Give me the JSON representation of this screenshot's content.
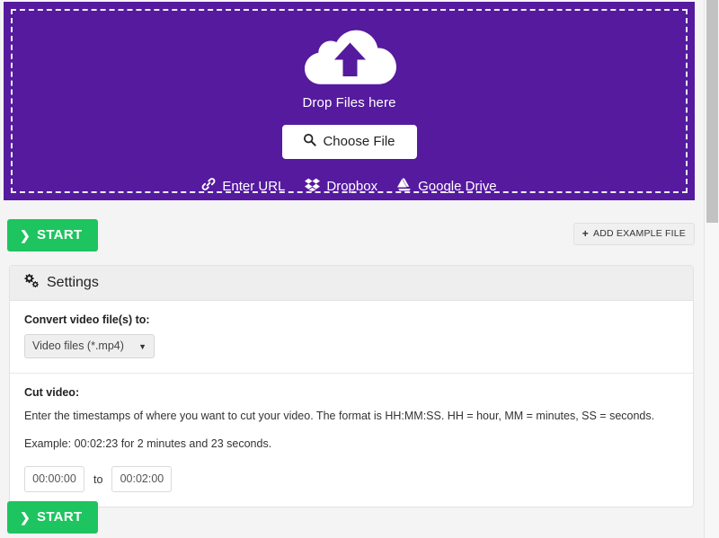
{
  "theme": {
    "dropzone_bg": "#551a9e",
    "start_green": "#1ec45f",
    "panel_header_bg": "#eeeeee",
    "page_bg": "#f4f4f4"
  },
  "dropzone": {
    "icon": "cloud-upload-icon",
    "drop_label": "Drop Files here",
    "choose_file_label": "Choose File",
    "choose_file_icon": "search-icon",
    "providers": [
      {
        "label": "Enter URL",
        "icon": "link-icon"
      },
      {
        "label": "Dropbox",
        "icon": "dropbox-icon"
      },
      {
        "label": "Google Drive",
        "icon": "google-drive-icon"
      }
    ]
  },
  "actions": {
    "start_label": "START",
    "start_icon": "chevron-right-icon",
    "add_example_label": "ADD EXAMPLE FILE",
    "add_example_icon": "plus-icon"
  },
  "settings": {
    "title": "Settings",
    "title_icon": "cogs-icon",
    "convert": {
      "label": "Convert video file(s) to:",
      "selected": "Video files (*.mp4)",
      "caret_icon": "chevron-down-icon",
      "options": [
        "Video files (*.mp4)"
      ]
    },
    "cut": {
      "label": "Cut video:",
      "hint_line_1": "Enter the timestamps of where you want to cut your video. The format is HH:MM:SS. HH = hour, MM = minutes, SS = seconds.",
      "hint_line_2": "Example: 00:02:23 for 2 minutes and 23 seconds.",
      "from_value": "00:00:00",
      "from_placeholder": "00:00:00",
      "to_label": "to",
      "to_value": "00:02:00",
      "to_placeholder": "00:02:00"
    }
  },
  "bottom": {
    "start_label": "START",
    "start_icon": "chevron-right-icon"
  }
}
